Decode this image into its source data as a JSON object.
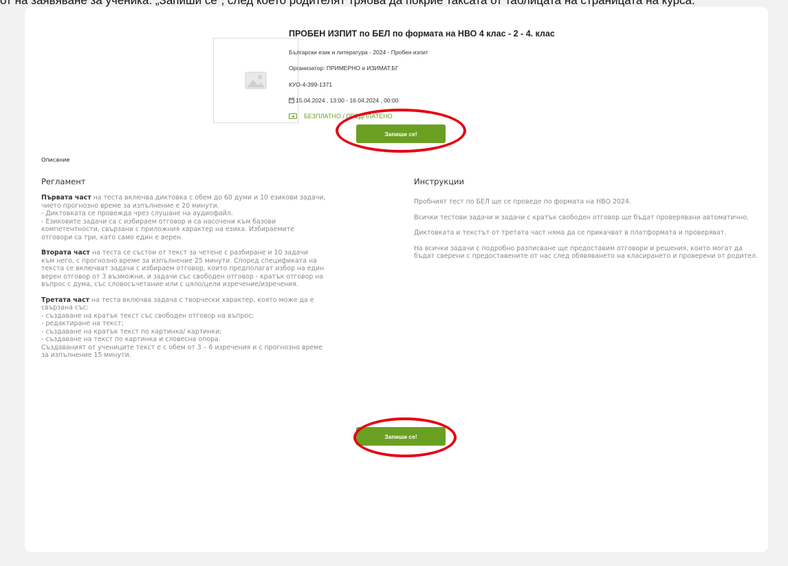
{
  "top_banner": "от на заявяване за ученика. „Запиши се“, след което родителят трябва да покрие таксата от таблицата на страницата на курса.",
  "event": {
    "title": "ПРОБЕН ИЗПИТ по БЕЛ по формата на НВО 4 клас - 2 - 4. клас",
    "subject": "Български език и литература - 2024 - Пробен изпит",
    "organizer": "Организатор: ПРИМЕРНО и ИЗИМАТ.БГ",
    "code": "КУО-4-399-1371",
    "dates": "15.04.2024 , 13:00 - 16.04.2024 , 00:00",
    "price": "БЕЗПЛАТНО / ПРЕДПЛАТЕНО"
  },
  "buttons": {
    "enroll_top": "Запиши се!",
    "enroll_bottom": "Запиши се!"
  },
  "description": {
    "label": "Описание",
    "left_heading": "Регламент",
    "right_heading": "Инструкции",
    "part1_bold": "Първата част",
    "part1_lines": [
      " на теста включва диктовка с обем до 60 думи и 10 езикови задачи,",
      "чието прогнозно време за изпълнение е 20 минути.",
      "- Диктовката се провежда чрез слушане на аудиофайл.",
      "- Езиковите задачи са с избираем отговор и са насочени към базови",
      "компетентности, свързани с приложния характер на езика. Избираемите",
      "отговори са три, като само един е верен."
    ],
    "part2_bold": "Втората част",
    "part2_lines": [
      " на теста се състои от текст за четене с разбиране и 10 задачи",
      "към него, с прогнозно време за изпълнение 25 минути. Според спецификата на",
      "текста се включват задачи с избираем отговор, които предполагат избор на един",
      "верен отговор от 3 възможни, и задачи със свободен отговор - кратък отговор на",
      "въпрос с дума, със словосъчетание или с цяло/цели изречение/изречения."
    ],
    "part3_bold": "Третата част",
    "part3_lines": [
      " на теста включва задача с творчески характер, която може да е",
      "свързана със:",
      "- създаване на кратък текст със свободен отговор на въпрос;",
      "- редактиране на текст;",
      "- създаване на кратък текст по картинка/ картинки;",
      "- създаване на текст по картинка и словесна опора.",
      "Създаваният от учениците текст е с обем от 3 – 6 изречения и с прогнозно време",
      "за изпълнение 15 минути."
    ],
    "instructions": [
      "Пробният тест по БЕЛ ще се проведе по формата на НВО 2024.",
      "Всички тестови задачи и задачи с кратък свободен отговор ще бъдат проверявани автоматично.",
      "Диктовката и текстът от третата част няма да се прикачват в платформата и проверяват.",
      "На всички задачи с подробно разписване ще предоставим отговори и решения, които могат да бъдат сверени с предоставените от нас след обявяването на класирането и проверени от родител."
    ]
  },
  "colors": {
    "accent": "#6aa022",
    "highlight": "#e60012"
  }
}
